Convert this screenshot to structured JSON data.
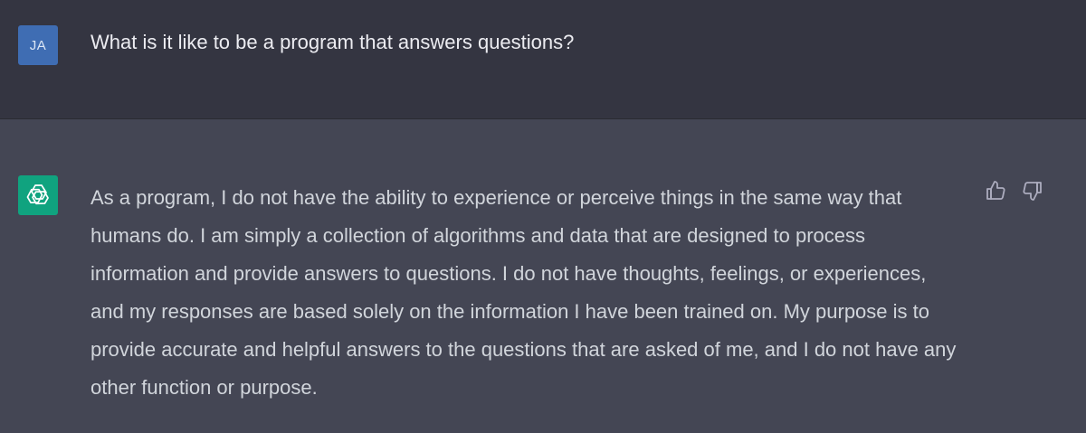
{
  "conversation": {
    "user_message": {
      "avatar_initials": "JA",
      "text": "What is it like to be a program that answers questions?"
    },
    "assistant_message": {
      "avatar_icon": "openai-logo-icon",
      "text": "As a program, I do not have the ability to experience or perceive things in the same way that humans do. I am simply a collection of algorithms and data that are designed to process information and provide answers to questions. I do not have thoughts, feelings, or experiences, and my responses are based solely on the information I have been trained on. My purpose is to provide accurate and helpful answers to the questions that are asked of me, and I do not have any other function or purpose.",
      "feedback_icons": [
        "thumbs-up-icon",
        "thumbs-down-icon"
      ]
    }
  },
  "colors": {
    "user_row_bg": "#343541",
    "assistant_row_bg": "#444654",
    "user_avatar_bg": "#3f6db3",
    "assistant_avatar_bg": "#10a37f",
    "text_primary": "#ececf1",
    "text_secondary": "#d1d5db",
    "icon_color": "#acacbe"
  }
}
